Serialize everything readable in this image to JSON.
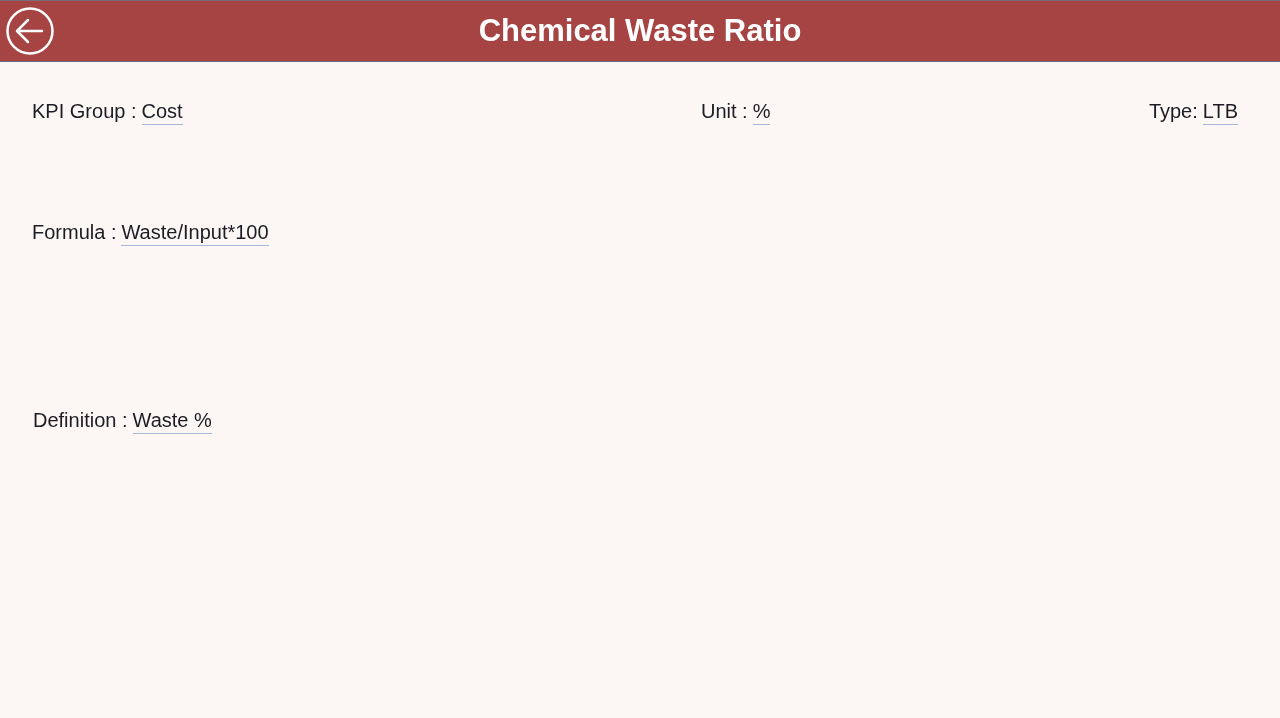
{
  "header": {
    "title": "Chemical Waste Ratio"
  },
  "summary": [
    {
      "label": "KPI Group :",
      "value": "Cost"
    },
    {
      "label": "Unit :",
      "value": "%"
    },
    {
      "label": "Type:",
      "value": "LTB"
    }
  ],
  "details": [
    {
      "label": "Formula :",
      "value": "Waste/Input*100"
    },
    {
      "label": "Definition :",
      "value": "Waste %"
    }
  ]
}
